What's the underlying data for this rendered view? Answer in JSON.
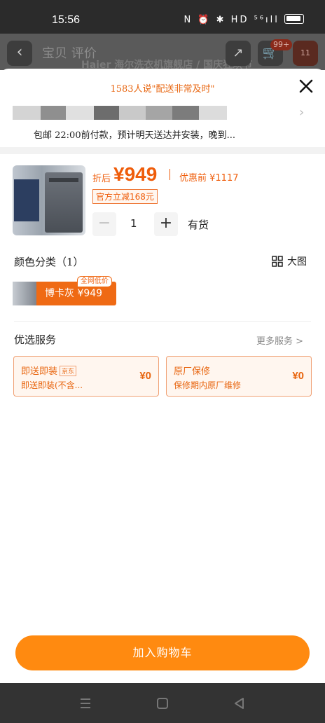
{
  "status_bar": {
    "time": "15:56",
    "icons_text": "N ⏰ ✱ HD ⁵⁶ıll"
  },
  "background_header": {
    "title": "宝贝  评价",
    "brand": "Haier 海尔洗衣机旗舰店 / 国庆狂欢节",
    "cart_badge": "99+",
    "menu_badge": "11"
  },
  "sheet": {
    "promo": "1583人说\"配送非常及时\"",
    "delivery": "包邮 22:00前付款，预计明天送达并安装，晚到...",
    "product": {
      "price_prefix": "折后",
      "price": "¥949",
      "original_price": "优惠前 ¥1117",
      "discount": "官方立减168元",
      "quantity": "1",
      "stock": "有货"
    },
    "color_section": {
      "title": "颜色分类（1）",
      "big_image": "大图",
      "option_label": "博卡灰  ¥949",
      "option_badge": "全网低价"
    },
    "service_section": {
      "title": "优选服务",
      "more": "更多服务 >",
      "services": [
        {
          "name": "即送即装",
          "badge": "京东",
          "desc": "即送即装(不含...",
          "price": "¥0"
        },
        {
          "name": "原厂保修",
          "desc": "保修期内原厂维修",
          "price": "¥0"
        }
      ]
    },
    "add_to_cart": "加入购物车"
  },
  "colors": {
    "accent": "#ef5d0b",
    "button": "#ff8a10"
  }
}
